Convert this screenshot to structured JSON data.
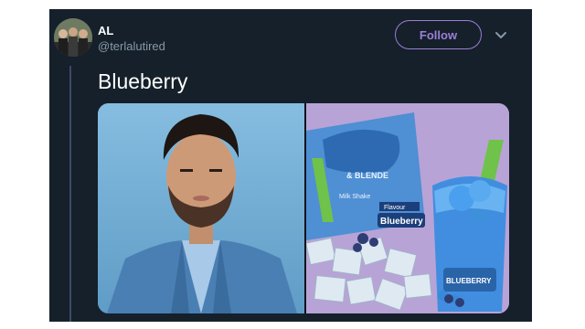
{
  "tweet": {
    "display_name": "AL",
    "handle": "@terlalutired",
    "follow_label": "Follow",
    "text": "Blueberry"
  },
  "media": {
    "left_image": "portrait-photo",
    "right_image": "blueberry-drink-photo",
    "product_text": {
      "blender": "& BLENDE",
      "milk_shake": "Milk Shake",
      "brand": "Flavour",
      "flavor": "Blueberry",
      "cup_label": "BLUEBERRY"
    }
  },
  "colors": {
    "background": "#15202b",
    "accent": "#9b7fd6",
    "text_primary": "#ffffff",
    "text_secondary": "#8899a6"
  },
  "icons": [
    "chevron-down-icon"
  ]
}
